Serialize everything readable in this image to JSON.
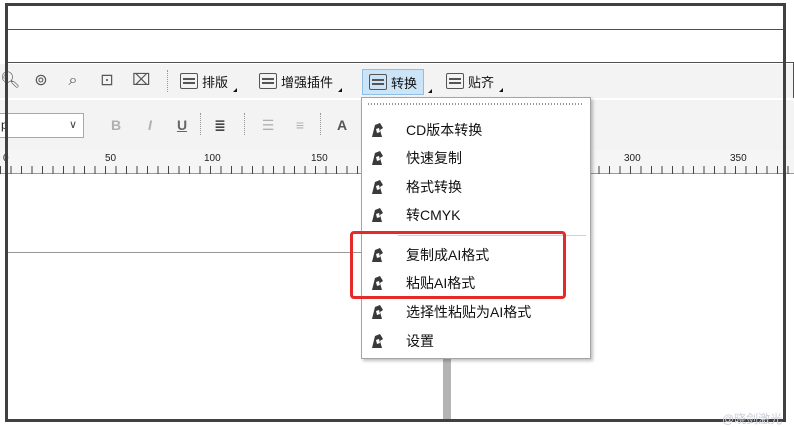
{
  "toolbar": {
    "buttons": [
      {
        "label": "排版",
        "active": false
      },
      {
        "label": "增强插件",
        "active": false
      },
      {
        "label": "转换",
        "active": true
      },
      {
        "label": "贴齐",
        "active": false
      }
    ],
    "icons": [
      "zoom-in-icon",
      "zoom-selection-icon",
      "zoom-page-icon",
      "zoom-width-icon",
      "zoom-height-icon"
    ]
  },
  "format_bar": {
    "font_combo_value": "p"
  },
  "ruler": {
    "labels": [
      "0",
      "50",
      "100",
      "150",
      "300",
      "350"
    ]
  },
  "menu": {
    "items": [
      {
        "label": "CD版本转换"
      },
      {
        "label": "快速复制"
      },
      {
        "label": "格式转换"
      },
      {
        "label": "转CMYK"
      },
      {
        "label": "复制成AI格式"
      },
      {
        "label": "粘贴AI格式"
      },
      {
        "label": "选择性粘贴为AI格式"
      },
      {
        "label": "设置"
      }
    ]
  },
  "watermark": "@晓剑激光",
  "colors": {
    "highlight": "#e52a2a",
    "active_button": "#cce4f7"
  }
}
